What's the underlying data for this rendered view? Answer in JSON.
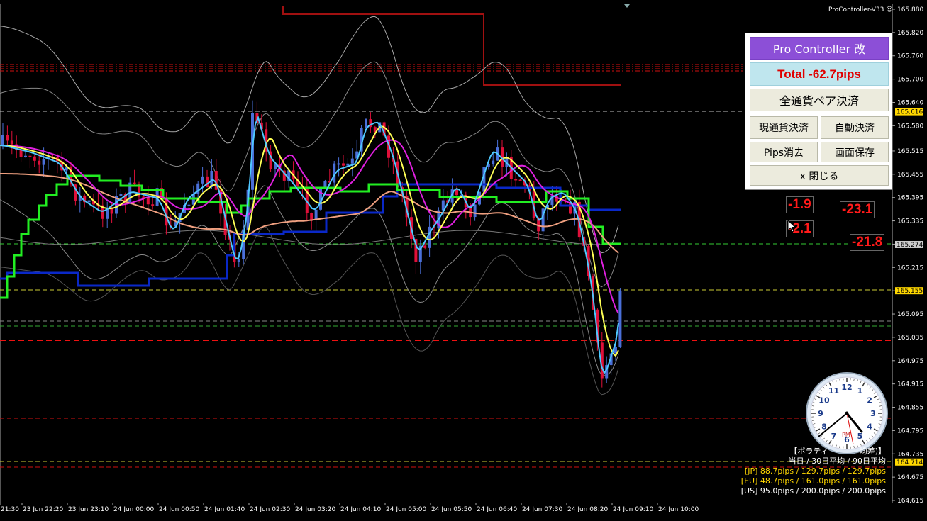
{
  "app": {
    "indicator_label": "ProController-V33",
    "smiley_icon": "smiley-icon"
  },
  "price_axis": {
    "ticks": [
      "165.880",
      "165.820",
      "165.760",
      "165.700",
      "165.640",
      "165.580",
      "165.515",
      "165.455",
      "165.395",
      "165.335",
      "165.275",
      "165.215",
      "165.155",
      "165.095",
      "165.035",
      "164.975",
      "164.915",
      "164.855",
      "164.795",
      "164.735",
      "164.675",
      "164.615"
    ],
    "markers": [
      {
        "label": "165.616",
        "color": "#ffd700",
        "text_color": "#000"
      },
      {
        "label": "165.274",
        "color": "#cccccc",
        "text_color": "#000"
      },
      {
        "label": "165.155",
        "color": "#ffd700",
        "text_color": "#000"
      },
      {
        "label": "164.714",
        "color": "#ffd700",
        "text_color": "#000"
      }
    ]
  },
  "time_axis": {
    "labels": [
      "21:30",
      "23 Jun 22:20",
      "23 Jun 23:10",
      "24 Jun 00:00",
      "24 Jun 00:50",
      "24 Jun 01:40",
      "24 Jun 02:30",
      "24 Jun 03:20",
      "24 Jun 04:10",
      "24 Jun 05:00",
      "24 Jun 05:50",
      "24 Jun 06:40",
      "24 Jun 07:30",
      "24 Jun 08:20",
      "24 Jun 09:10",
      "24 Jun 10:00"
    ]
  },
  "panel": {
    "title": "Pro Controller 改",
    "total": "Total   -62.7pips",
    "close_all_pairs": "全通貨ペア決済",
    "close_current": "現通貨決済",
    "auto_close": "自動決済",
    "clear_pips": "Pips消去",
    "save_screen": "画面保存",
    "close": "x 閉じる"
  },
  "pips_labels": [
    "-1.9",
    "-23.1",
    "-2.1",
    "-21.8"
  ],
  "stats": {
    "header": "【ボラティ　　　　均差)】",
    "subheader": "当日 / 30日平均 / 90日平均",
    "jp": "[JP] 88.7pips / 129.7pips / 129.7pips",
    "eu": "[EU] 48.7pips / 161.0pips / 161.0pips",
    "us": "[US] 95.0pips / 200.0pips / 200.0pips"
  },
  "clock": {
    "numbers": [
      "12",
      "1",
      "2",
      "3",
      "4",
      "5",
      "6",
      "7",
      "8",
      "9",
      "10",
      "11"
    ],
    "ampm": "PM"
  },
  "colors": {
    "bull_candle": "#4a6fd8",
    "bear_candle": "#e0103a",
    "ma_green": "#22ee22",
    "ma_yellow": "#ffff55",
    "ma_magenta": "#e020e0",
    "ma_cyan": "#4fc8ff",
    "ma_salmon": "#f0a080",
    "line_blue": "#0a28c8"
  }
}
